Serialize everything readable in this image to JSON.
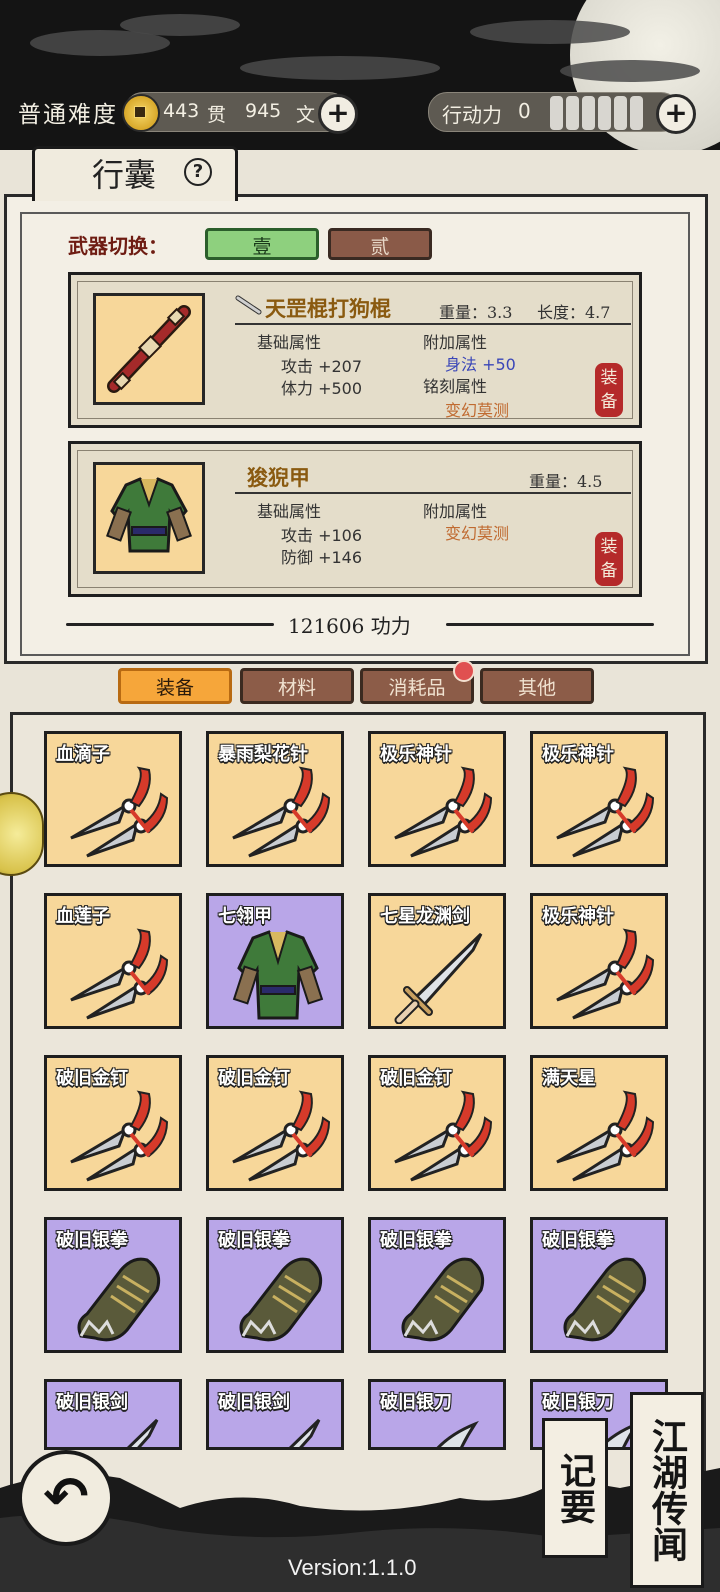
{
  "header": {
    "difficulty": "普通难度",
    "money": {
      "guan_value": "443",
      "guan_unit": "贯",
      "wen_value": "945",
      "wen_unit": "文"
    },
    "action_label": "行动力",
    "action_value": "0",
    "plus": "+"
  },
  "bag": {
    "title": "行囊",
    "help": "?",
    "weapon_switch_label": "武器切换：",
    "weapon_slot_1": "壹",
    "weapon_slot_2": "贰",
    "equipped": [
      {
        "name": "天罡棍打狗棍",
        "weight": "重量：3.3",
        "length": "长度：4.7",
        "base_title": "基础属性",
        "base_1": "攻击 +207",
        "base_2": "体力 +500",
        "extra_title": "附加属性",
        "extra_1": "身法 +50",
        "engrave_title": "铭刻属性",
        "engrave_1": "变幻莫测",
        "equip_top": "装",
        "equip_bottom": "备"
      },
      {
        "name": "狻猊甲",
        "weight": "重量：4.5",
        "base_title": "基础属性",
        "base_1": "攻击 +106",
        "base_2": "防御 +146",
        "extra_title": "附加属性",
        "extra_1": "变幻莫测",
        "equip_top": "装",
        "equip_bottom": "备"
      }
    ],
    "power": "121606 功力"
  },
  "categories": [
    "装备",
    "材料",
    "消耗品",
    "其他"
  ],
  "items": [
    {
      "name": "血滴子",
      "rarity": "yellow",
      "icon": "dart-icon"
    },
    {
      "name": "暴雨梨花针",
      "rarity": "yellow",
      "icon": "dart-icon"
    },
    {
      "name": "极乐神针",
      "rarity": "yellow",
      "icon": "dart-icon"
    },
    {
      "name": "极乐神针",
      "rarity": "yellow",
      "icon": "dart-icon"
    },
    {
      "name": "血莲子",
      "rarity": "yellow",
      "icon": "dart-icon"
    },
    {
      "name": "七翎甲",
      "rarity": "purple",
      "icon": "armor-icon"
    },
    {
      "name": "七星龙渊剑",
      "rarity": "yellow",
      "icon": "sword-icon"
    },
    {
      "name": "极乐神针",
      "rarity": "yellow",
      "icon": "dart-icon"
    },
    {
      "name": "破旧金钉",
      "rarity": "yellow",
      "icon": "dart-icon"
    },
    {
      "name": "破旧金钉",
      "rarity": "yellow",
      "icon": "dart-icon"
    },
    {
      "name": "破旧金钉",
      "rarity": "yellow",
      "icon": "dart-icon"
    },
    {
      "name": "满天星",
      "rarity": "yellow",
      "icon": "dart-icon"
    },
    {
      "name": "破旧银拳",
      "rarity": "purple",
      "icon": "gauntlet-icon"
    },
    {
      "name": "破旧银拳",
      "rarity": "purple",
      "icon": "gauntlet-icon"
    },
    {
      "name": "破旧银拳",
      "rarity": "purple",
      "icon": "gauntlet-icon"
    },
    {
      "name": "破旧银拳",
      "rarity": "purple",
      "icon": "gauntlet-icon"
    },
    {
      "name": "破旧银剑",
      "rarity": "purple",
      "icon": "sword-icon"
    },
    {
      "name": "破旧银剑",
      "rarity": "purple",
      "icon": "sword-icon"
    },
    {
      "name": "破旧银刀",
      "rarity": "purple",
      "icon": "blade-icon"
    },
    {
      "name": "破旧银刀",
      "rarity": "purple",
      "icon": "blade-icon"
    }
  ],
  "footer": {
    "back": "↶",
    "notes": "记要",
    "legends": "江湖传闻",
    "version": "Version:1.1.0"
  }
}
